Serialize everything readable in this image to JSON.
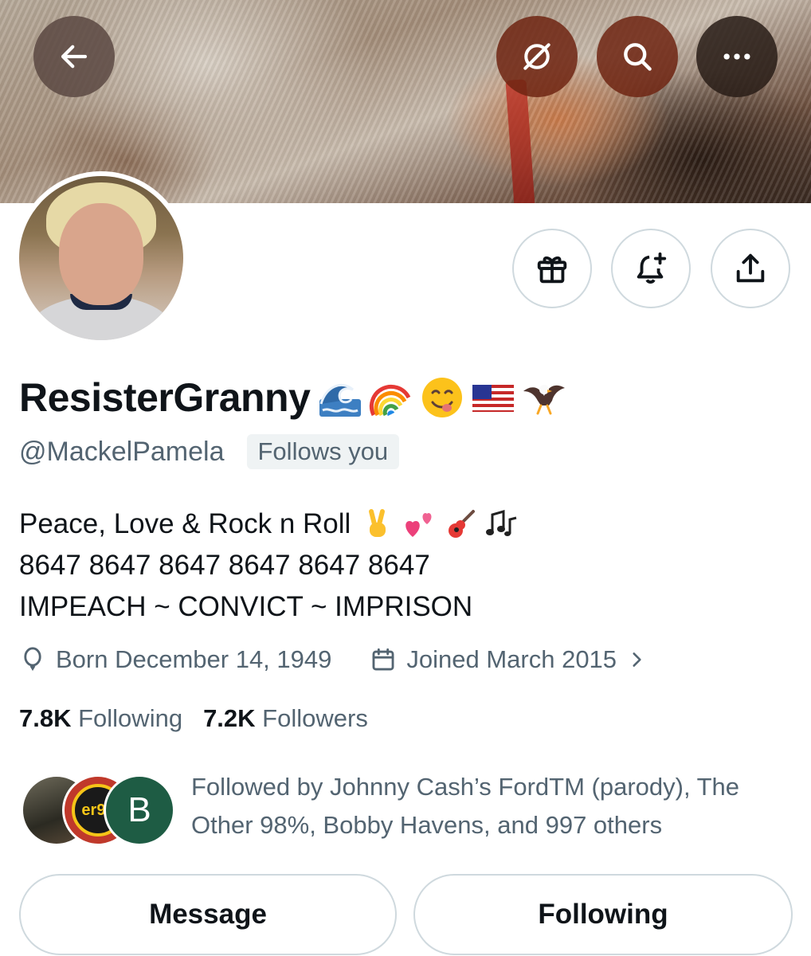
{
  "header": {
    "back_icon": "arrow-left-icon",
    "grok_icon": "grok-slash-icon",
    "search_icon": "search-icon",
    "more_icon": "more-dots-icon"
  },
  "profile": {
    "display_name": "ResisterGranny",
    "name_emojis": [
      "🌊",
      "🌈",
      "😋",
      "🇺🇸",
      "🦅"
    ],
    "handle": "@MackelPamela",
    "follows_you": "Follows you",
    "bio_line1": "Peace, Love & Rock n Roll",
    "bio_line1_emojis": [
      "✌️",
      "💕",
      "🎸",
      "🎶"
    ],
    "bio_line2": "8647 8647 8647 8647 8647 8647",
    "bio_line3": "IMPEACH ~ CONVICT ~ IMPRISON",
    "born": "Born December 14, 1949",
    "joined": "Joined March 2015",
    "following_count": "7.8K",
    "following_label": "Following",
    "followers_count": "7.2K",
    "followers_label": "Followers",
    "followed_by_text": "Followed by Johnny Cash’s FordTM (parody), The Other 98%, Bobby Havens, and 997 others",
    "follower_av2_text": "er98",
    "follower_av3_letter": "B"
  },
  "actions": {
    "gift_icon": "gift-icon",
    "bell_icon": "bell-plus-icon",
    "share_icon": "share-icon",
    "message_label": "Message",
    "following_label": "Following"
  },
  "colors": {
    "text_primary": "#0f1419",
    "text_secondary": "#536471",
    "border": "#cfd9de"
  }
}
